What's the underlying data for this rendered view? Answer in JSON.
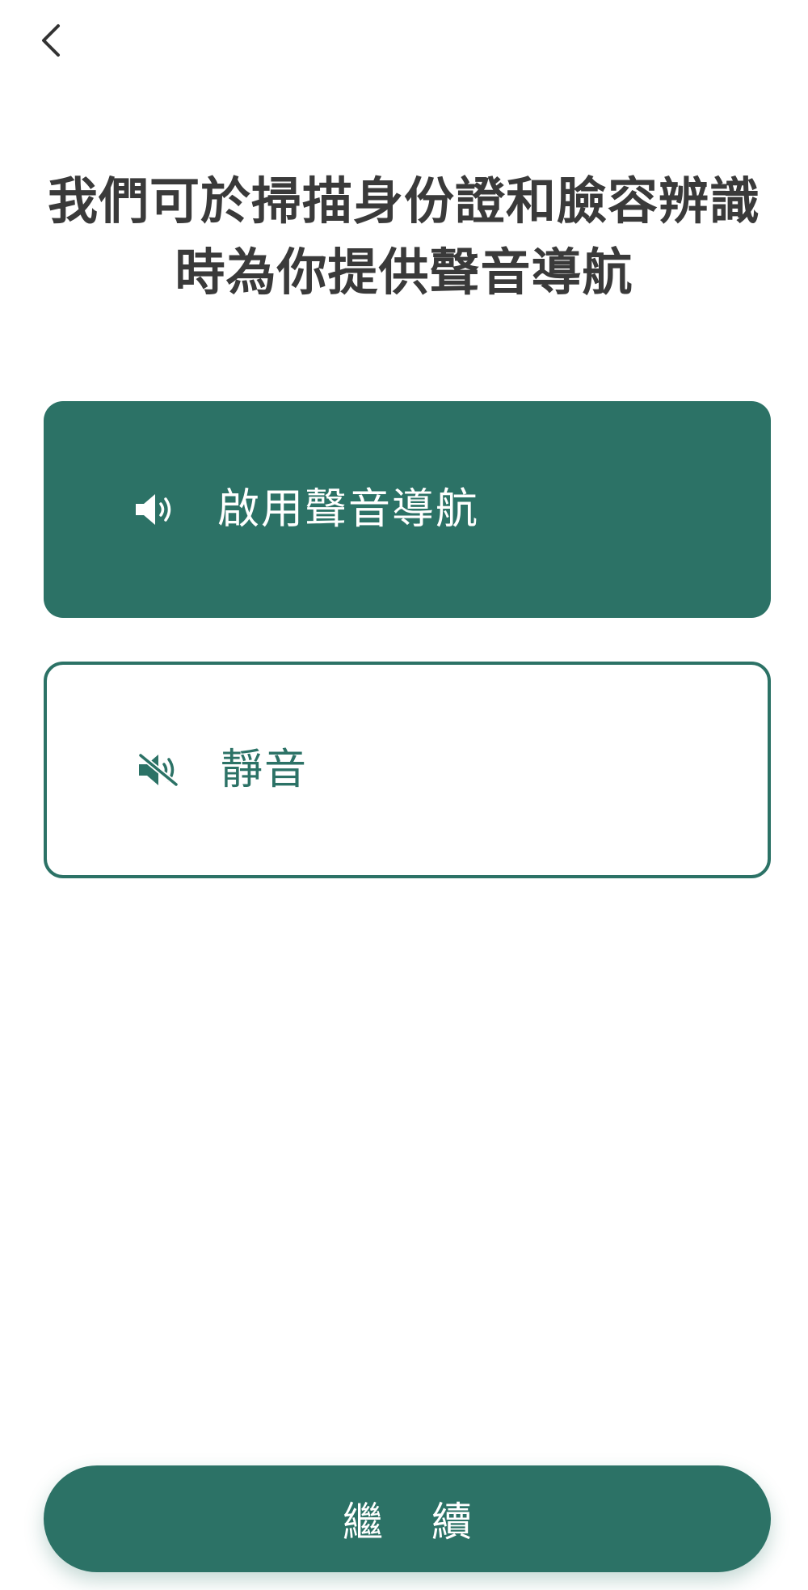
{
  "header": {
    "back_icon": "chevron-left-icon"
  },
  "title": {
    "line1": "我們可於掃描身份證和臉容辨識",
    "line2": "時為你提供聲音導航"
  },
  "options": [
    {
      "label": "啟用聲音導航",
      "icon": "speaker-on-icon",
      "selected": true
    },
    {
      "label": "靜音",
      "icon": "speaker-muted-icon",
      "selected": false
    }
  ],
  "footer": {
    "continue_label": "繼 續"
  },
  "colors": {
    "accent": "#2c7266",
    "title_text": "#3a3a3a",
    "background": "#ffffff"
  }
}
